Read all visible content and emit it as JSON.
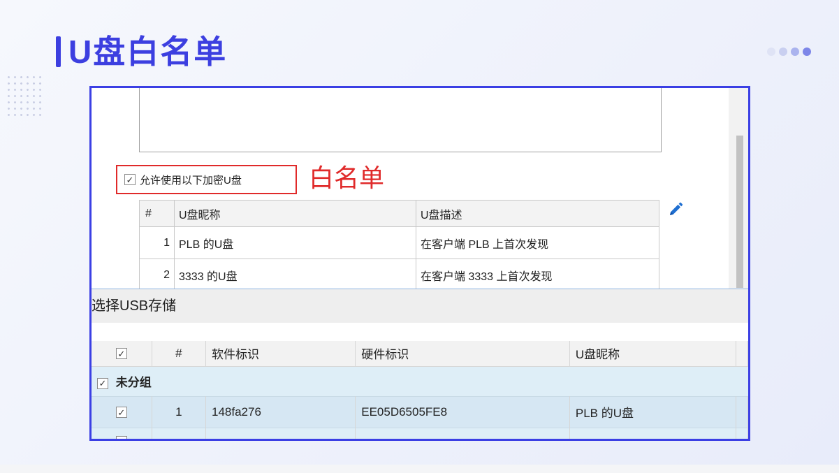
{
  "slide": {
    "title": "U盘白名单",
    "colors": {
      "accent": "#3c3fe0",
      "annotation": "#e02a2a",
      "row_highlight": "#deeef7"
    }
  },
  "whitelist_panel": {
    "allow_checkbox_label": "允许使用以下加密U盘",
    "allow_checked": true,
    "annotation": "白名单",
    "edit_icon": "pencil-icon",
    "columns": [
      "#",
      "U盘昵称",
      "U盘描述"
    ],
    "rows": [
      {
        "index": "1",
        "nickname": "PLB 的U盘",
        "description": "在客户端 PLB 上首次发现"
      },
      {
        "index": "2",
        "nickname": "3333 的U盘",
        "description": "在客户端 3333 上首次发现"
      }
    ]
  },
  "usb_dialog": {
    "title": "选择USB存储",
    "columns": [
      "",
      "#",
      "软件标识",
      "硬件标识",
      "U盘昵称"
    ],
    "group": {
      "label": "未分组",
      "checked": true
    },
    "rows": [
      {
        "checked": true,
        "index": "1",
        "software_id": "148fa276",
        "hardware_id": "EE05D6505FE8",
        "nickname": "PLB 的U盘"
      },
      {
        "checked": false,
        "index": "",
        "software_id": "",
        "hardware_id": "",
        "nickname": ""
      }
    ]
  }
}
